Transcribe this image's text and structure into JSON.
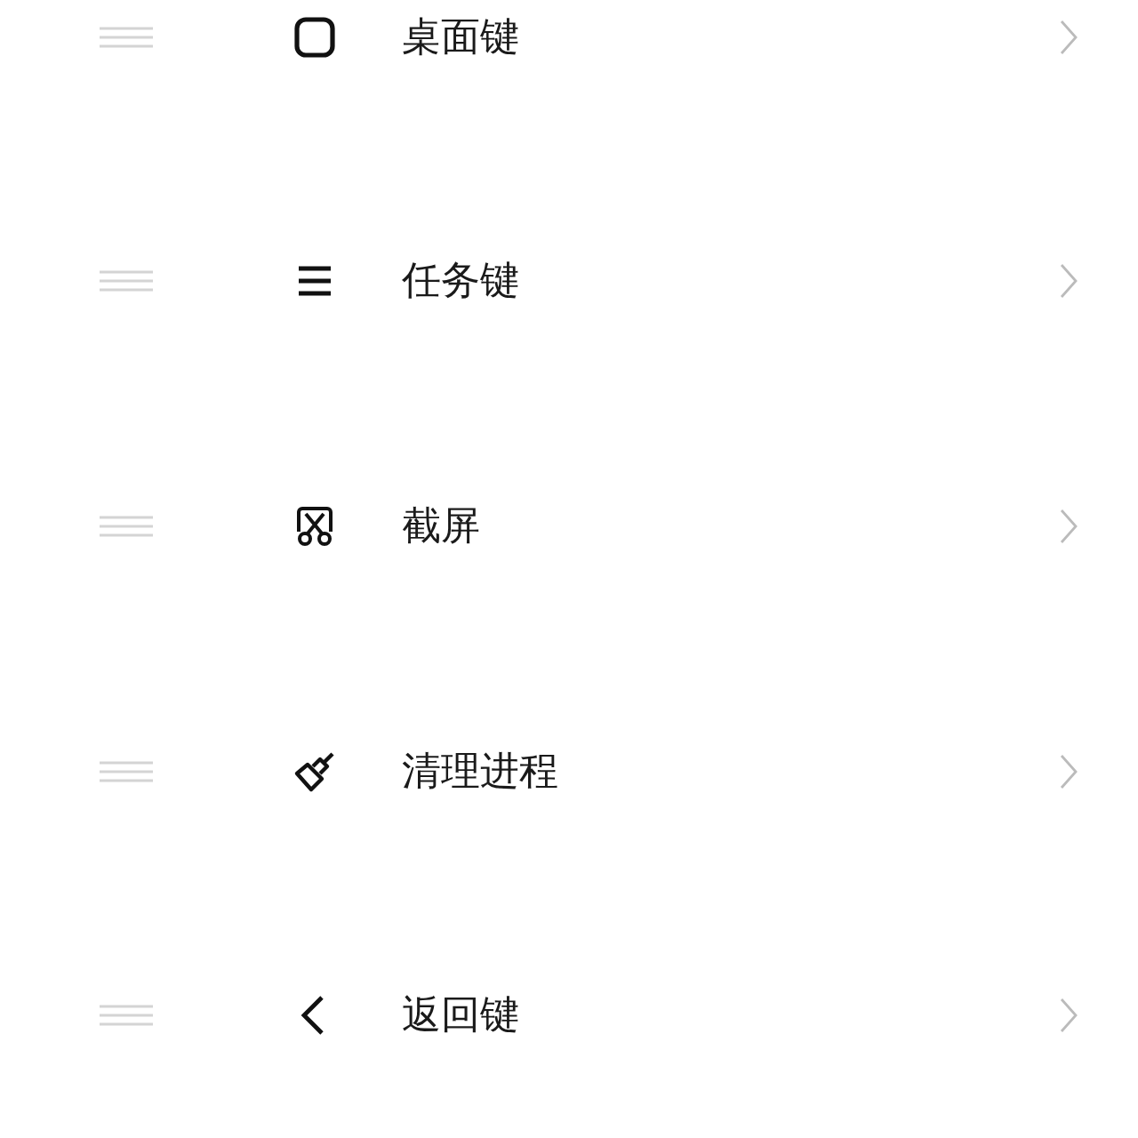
{
  "items": [
    {
      "kind": "home",
      "label": "桌面键"
    },
    {
      "kind": "recents",
      "label": "任务键"
    },
    {
      "kind": "screenshot",
      "label": "截屏"
    },
    {
      "kind": "clean",
      "label": "清理进程"
    },
    {
      "kind": "back",
      "label": "返回键"
    }
  ]
}
